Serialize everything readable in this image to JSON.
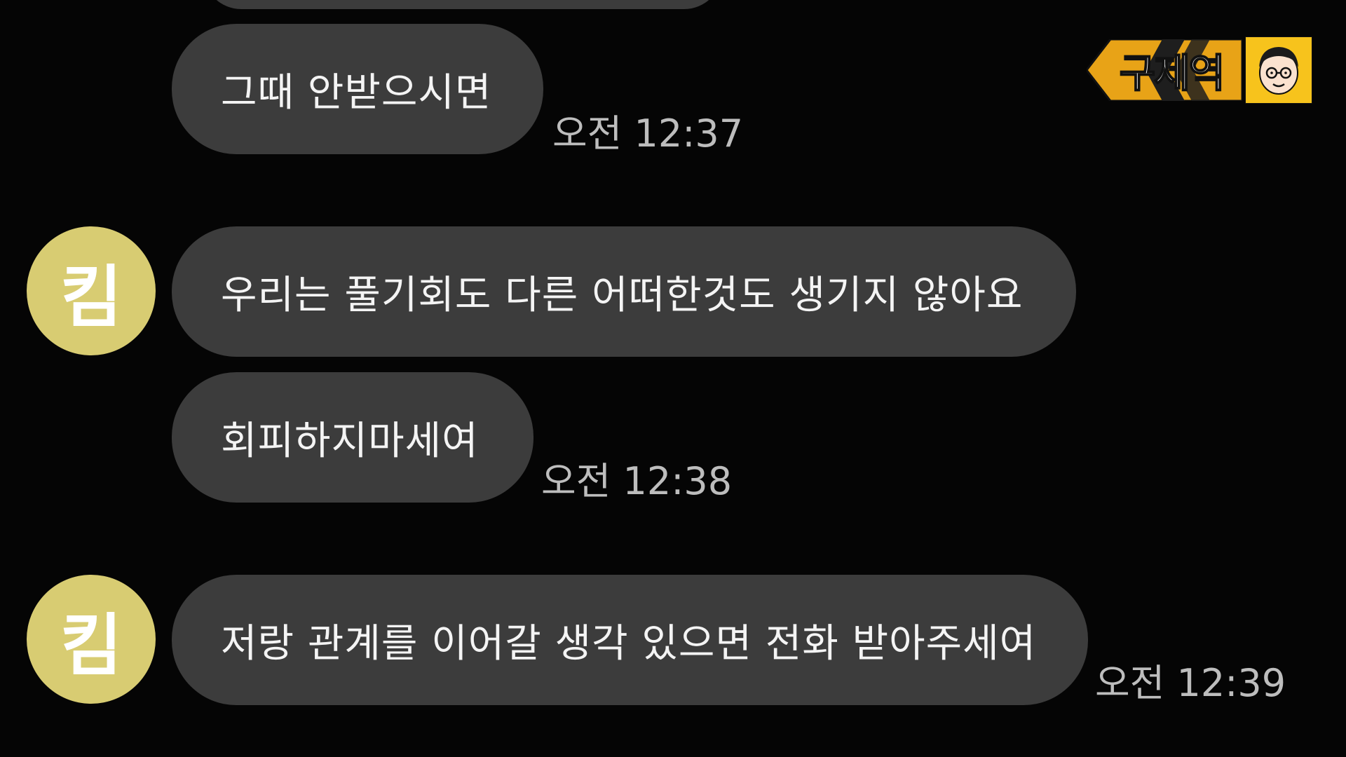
{
  "channel_logo": {
    "text": "구제역",
    "banner_color": "#e8a317",
    "badge_color": "#f7c31c",
    "face_icon": "cartoon-face-icon"
  },
  "colors": {
    "background": "#050505",
    "bubble": "#3c3c3c",
    "avatar": "#d8cc72",
    "timestamp": "#bdbdbd"
  },
  "messages": [
    {
      "text": "",
      "time": ""
    },
    {
      "text": "그때 안받으시면",
      "time": "오전 12:37"
    },
    {
      "text": "우리는 풀기회도 다른 어떠한것도 생기지 않아요",
      "time": "",
      "avatar_initial": "킴"
    },
    {
      "text": "회피하지마세여",
      "time": "오전 12:38"
    },
    {
      "text": "저랑 관계를 이어갈 생각 있으면 전화 받아주세여",
      "time": "오전 12:39",
      "avatar_initial": "킴"
    }
  ]
}
